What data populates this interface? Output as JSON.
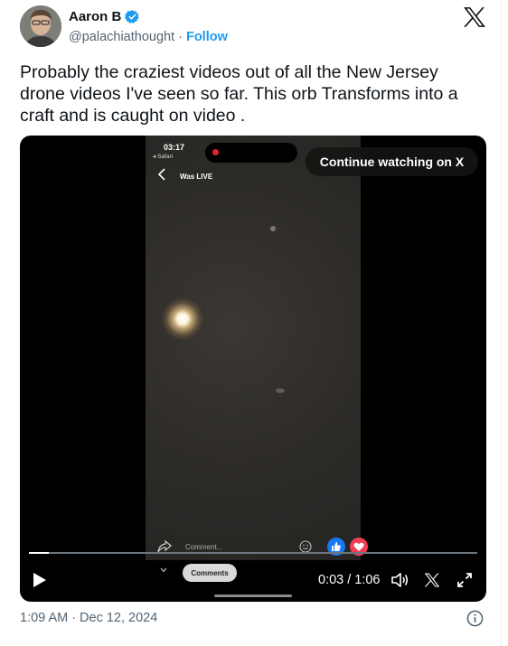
{
  "author": {
    "display_name": "Aaron B",
    "handle": "@palachiathought",
    "separator": "·",
    "follow_label": "Follow",
    "verified_icon": "verified-badge-icon"
  },
  "tweet": {
    "text": "Probably the craziest videos out of all the New Jersey drone videos I've seen so far. This orb Transforms into a craft and is caught on video ."
  },
  "video": {
    "overlay_button": "Continue watching on X",
    "phone": {
      "status_time": "03:17",
      "status_app": "◂ Safari",
      "live_label": "Was LIVE",
      "comment_placeholder": "Comment...",
      "comments_button": "Comments"
    },
    "player": {
      "current_time": "0:03",
      "time_separator": "/",
      "duration": "1:06",
      "progress_fraction": 0.045
    }
  },
  "footer": {
    "time": "1:09 AM",
    "separator": "·",
    "date": "Dec 12, 2024"
  },
  "colors": {
    "link_blue": "#1d9bf0",
    "text_primary": "#0f1419",
    "text_secondary": "#536471"
  }
}
